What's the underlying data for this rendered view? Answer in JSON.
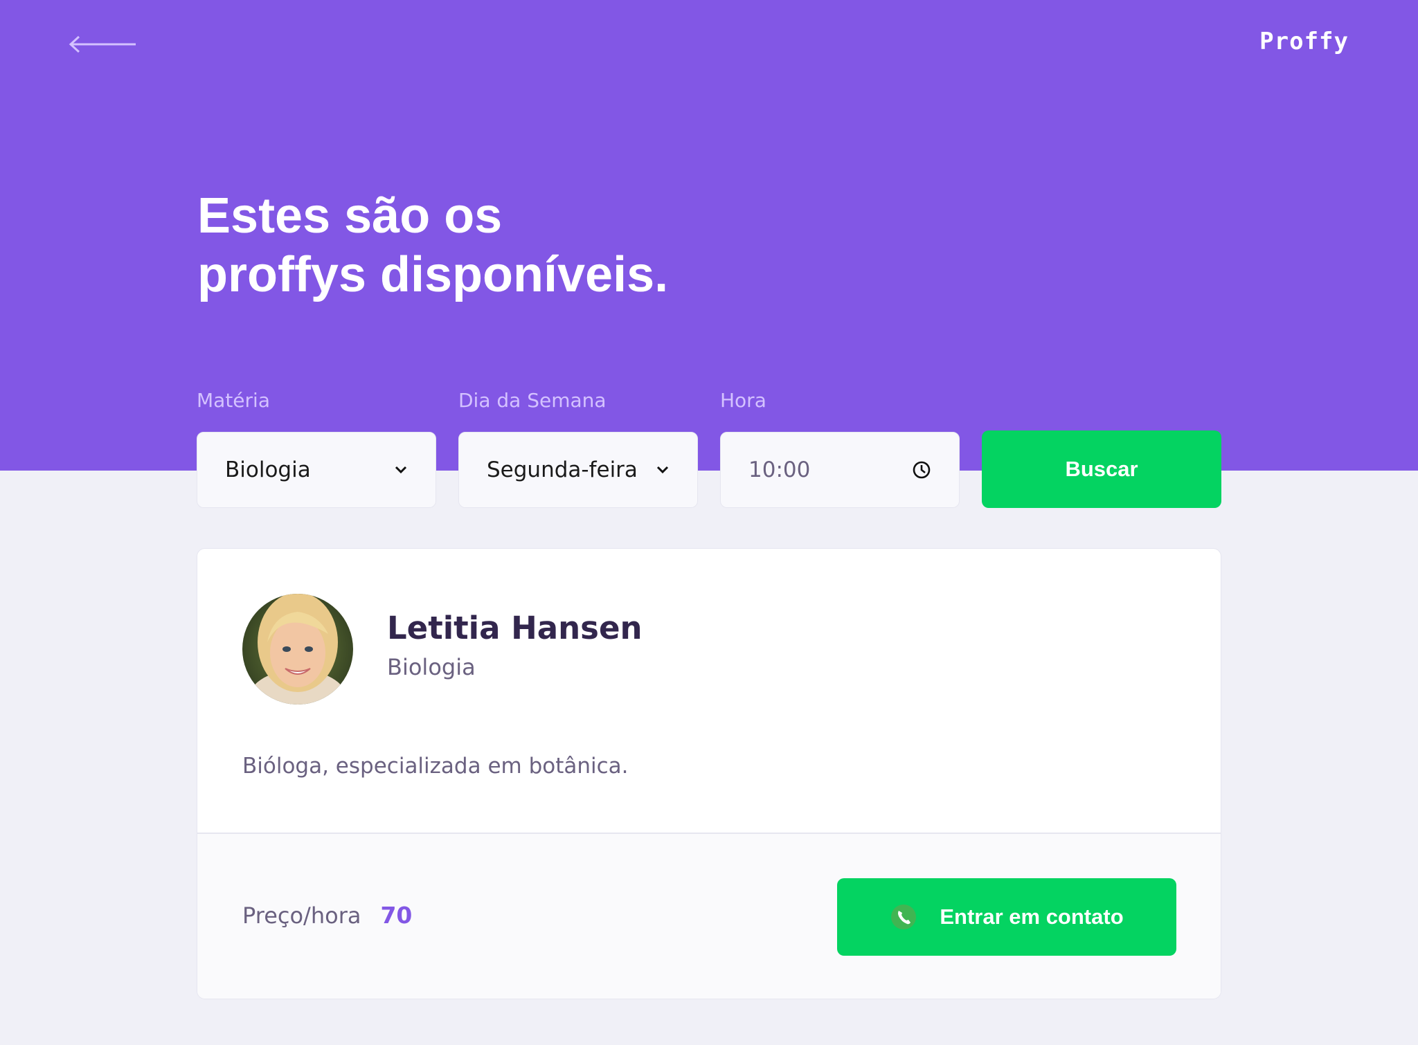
{
  "header": {
    "logo": "Proffy",
    "title_line1": "Estes são os",
    "title_line2": "proffys disponíveis.",
    "back_icon": "arrow-left-icon"
  },
  "filters": {
    "subject": {
      "label": "Matéria",
      "value": "Biologia"
    },
    "weekday": {
      "label": "Dia da Semana",
      "value": "Segunda-feira"
    },
    "time": {
      "label": "Hora",
      "value": "10:00"
    },
    "search_button": "Buscar"
  },
  "teacher": {
    "name": "Letitia Hansen",
    "subject": "Biologia",
    "bio": "Bióloga, especializada em botânica.",
    "price_label": "Preço/hora",
    "price_value": "70",
    "contact_button": "Entrar em contato"
  },
  "colors": {
    "primary": "#8257E5",
    "secondary": "#04D361",
    "background": "#F0F0F7",
    "text_title": "#32264D",
    "text_base": "#6A6180"
  }
}
